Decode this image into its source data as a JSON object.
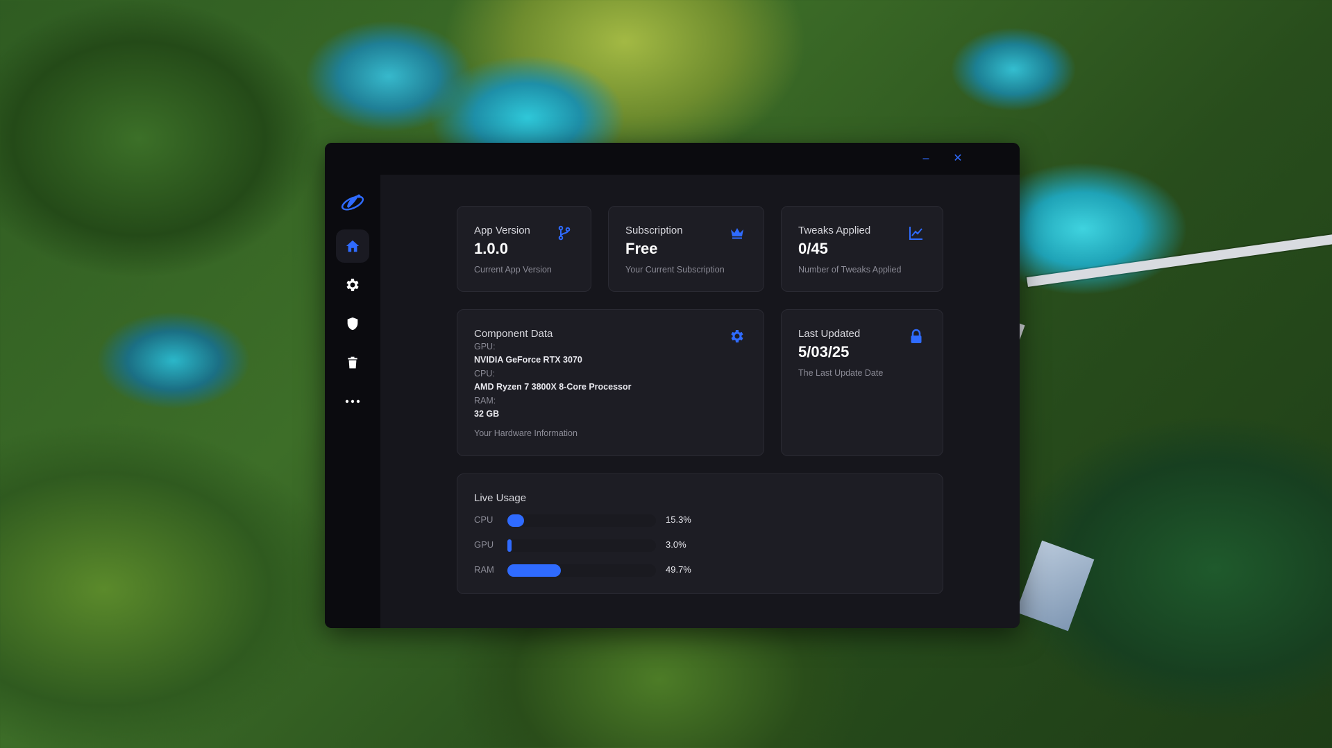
{
  "window": {
    "minimize_symbol": "–",
    "close_symbol": "✕"
  },
  "sidebar": {
    "items": [
      {
        "name": "home",
        "icon": "home-icon",
        "active": true
      },
      {
        "name": "settings",
        "icon": "gear-icon",
        "active": false
      },
      {
        "name": "security",
        "icon": "shield-icon",
        "active": false
      },
      {
        "name": "cleaner",
        "icon": "trash-icon",
        "active": false
      },
      {
        "name": "more",
        "icon": "more-icon",
        "active": false
      }
    ]
  },
  "cards": {
    "app_version": {
      "title": "App Version",
      "value": "1.0.0",
      "subtitle": "Current App Version",
      "icon": "branch-icon"
    },
    "subscription": {
      "title": "Subscription",
      "value": "Free",
      "subtitle": "Your Current Subscription",
      "icon": "crown-icon"
    },
    "tweaks": {
      "title": "Tweaks Applied",
      "value": "0/45",
      "subtitle": "Number of Tweaks Applied",
      "icon": "chart-line-icon"
    },
    "component": {
      "title": "Component Data",
      "icon": "gear-icon",
      "gpu_label": "GPU:",
      "gpu_value": "NVIDIA GeForce RTX 3070",
      "cpu_label": "CPU:",
      "cpu_value": "AMD Ryzen 7 3800X 8-Core Processor",
      "ram_label": "RAM:",
      "ram_value": "32 GB",
      "subtitle": "Your Hardware Information"
    },
    "last_updated": {
      "title": "Last Updated",
      "value": "5/03/25",
      "subtitle": "The Last Update Date",
      "icon": "lock-icon"
    }
  },
  "live_usage": {
    "title": "Live Usage",
    "rows": [
      {
        "label": "CPU",
        "value": "15.3%",
        "fraction": 0.153
      },
      {
        "label": "GPU",
        "value": "3.0%",
        "fraction": 0.03
      },
      {
        "label": "RAM",
        "value": "49.7%",
        "fraction": 0.497
      }
    ]
  },
  "colors": {
    "accent": "#2f6bff",
    "window_bg": "#16161c",
    "card_bg": "#1d1d24",
    "sidebar_bg": "#0b0b0f"
  }
}
